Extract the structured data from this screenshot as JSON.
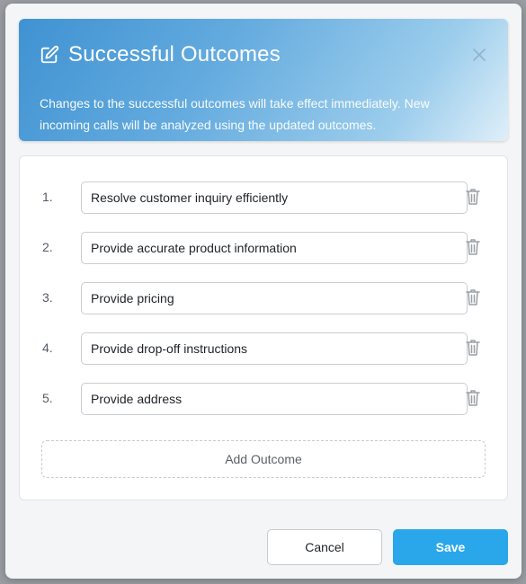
{
  "modal": {
    "title": "Successful Outcomes",
    "subtitle": "Changes to the successful outcomes will take effect immediately. New incoming calls will be analyzed using the updated outcomes.",
    "icons": {
      "title": "edit-icon",
      "close": "close-icon",
      "row_action": "trash-icon"
    },
    "colors": {
      "header_start": "#3f92d2",
      "header_end": "#dfeff9",
      "primary": "#2aa7ea"
    }
  },
  "outcomes": [
    {
      "number": "1.",
      "value": "Resolve customer inquiry efficiently"
    },
    {
      "number": "2.",
      "value": "Provide accurate product information"
    },
    {
      "number": "3.",
      "value": "Provide pricing"
    },
    {
      "number": "4.",
      "value": "Provide drop-off instructions"
    },
    {
      "number": "5.",
      "value": "Provide address"
    }
  ],
  "add_outcome_label": "Add Outcome",
  "footer": {
    "cancel_label": "Cancel",
    "save_label": "Save"
  }
}
